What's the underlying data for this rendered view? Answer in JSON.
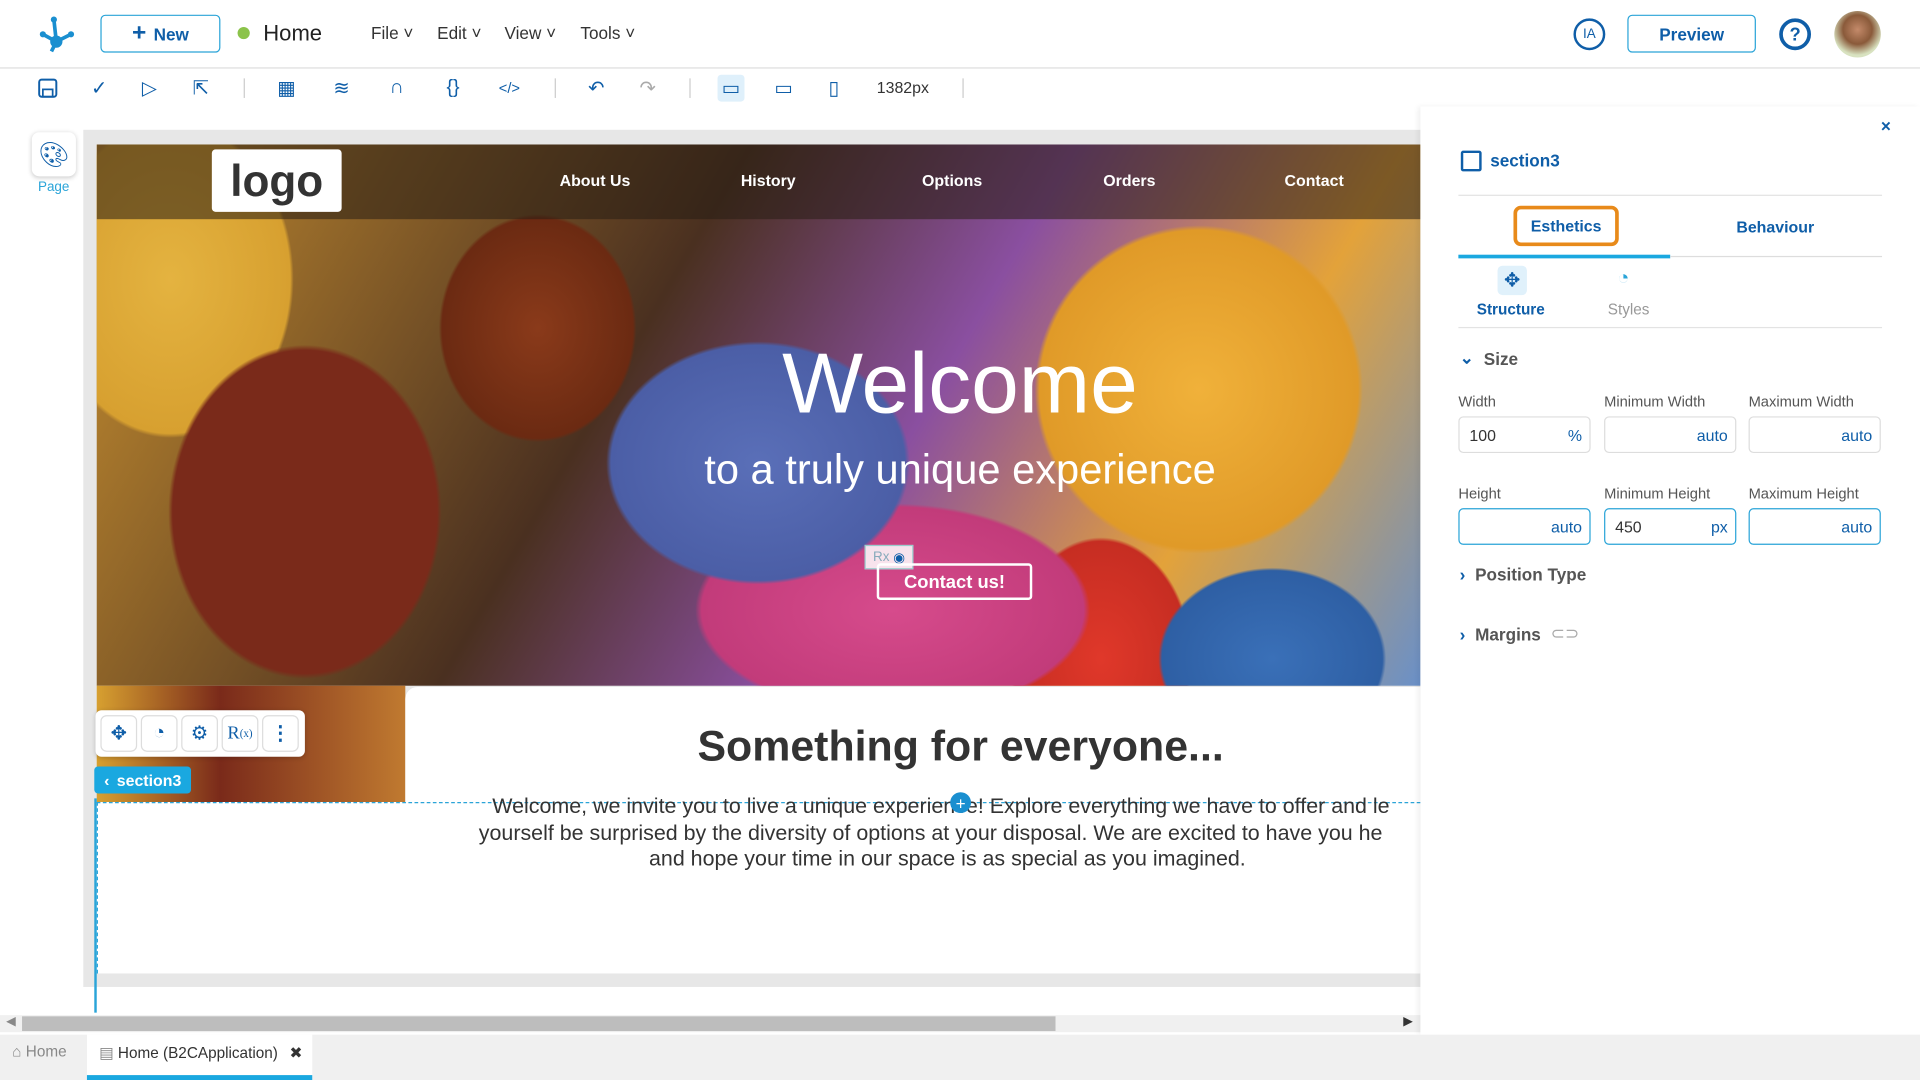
{
  "header": {
    "new_label": "New",
    "page_name": "Home",
    "status_color": "#8bc34a",
    "menus": [
      "File",
      "Edit",
      "View",
      "Tools"
    ],
    "ia_label": "IA",
    "preview_label": "Preview"
  },
  "toolbar": {
    "width_readout": "1382px"
  },
  "left_rail": {
    "page_label": "Page"
  },
  "site": {
    "logo": "logo",
    "nav": [
      "About Us",
      "History",
      "Options",
      "Orders",
      "Contact"
    ],
    "hero_title": "Welcome",
    "hero_subtitle": "to a truly unique experience",
    "rx_badge": "Rx",
    "cta": "Contact us!",
    "section_title": "Something for everyone...",
    "section_text_1": "Welcome, we invite you to live a unique experience! Explore everything we have to offer and le",
    "section_text_2": "yourself be surprised by the diversity of options at your disposal. We are excited to have you he",
    "section_text_3": "and hope your time in our space is as special as you imagined."
  },
  "selection": {
    "label": "section3",
    "tools": [
      "structure",
      "styles",
      "settings",
      "Rx",
      "more"
    ],
    "rx_text": "R",
    "rx_sub": "(x)"
  },
  "panel": {
    "element_name": "section3",
    "tabs": [
      "Esthetics",
      "Behaviour"
    ],
    "subtabs": [
      "Structure",
      "Styles"
    ],
    "size_label": "Size",
    "fields": [
      {
        "label": "Width",
        "value": "100",
        "unit": "%"
      },
      {
        "label": "Minimum Width",
        "value": "",
        "unit": "auto"
      },
      {
        "label": "Maximum Width",
        "value": "",
        "unit": "auto"
      },
      {
        "label": "Height",
        "value": "",
        "unit": "auto"
      },
      {
        "label": "Minimum Height",
        "value": "450",
        "unit": "px"
      },
      {
        "label": "Maximum Height",
        "value": "",
        "unit": "auto"
      }
    ],
    "position_type": "Position Type",
    "margins": "Margins"
  },
  "bottom_tabs": [
    {
      "label": "Home"
    },
    {
      "label": "Home (B2CApplication)",
      "active": true
    }
  ],
  "colors": {
    "accent": "#0f5ea8",
    "highlight": "#2aa4d8",
    "tab_focus": "#e88a1a"
  }
}
